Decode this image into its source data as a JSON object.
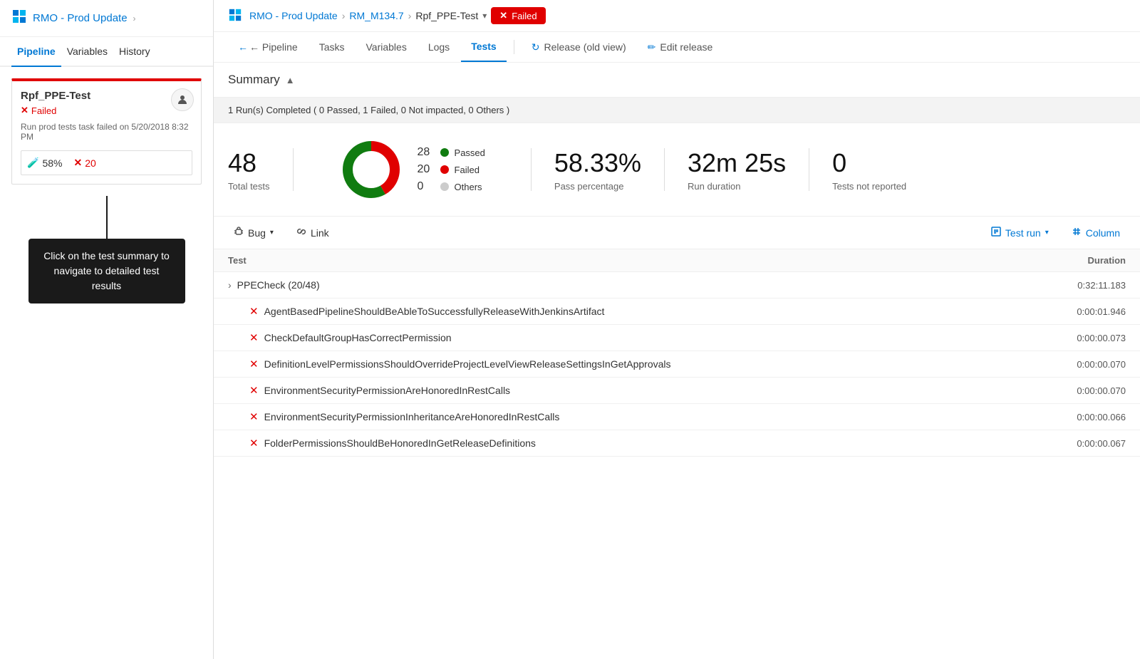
{
  "leftPanel": {
    "appIcon": "↑",
    "appTitle": "RMO - Prod Update",
    "navItems": [
      "Pipeline",
      "Variables",
      "History"
    ],
    "activeNavItem": "Pipeline",
    "stageCard": {
      "name": "Rpf_PPE-Test",
      "status": "Failed",
      "info": "Run prod tests task failed on 5/20/2018 8:32 PM",
      "passPercent": "58%",
      "failCount": "20"
    },
    "tooltip": "Click on the test summary to navigate to detailed test results"
  },
  "rightPanel": {
    "breadcrumb": {
      "appIcon": "↑",
      "appTitle": "RMO - Prod Update",
      "release": "RM_M134.7",
      "stage": "Rpf_PPE-Test",
      "status": "Failed"
    },
    "navItems": [
      {
        "label": "← Pipeline",
        "id": "pipeline"
      },
      {
        "label": "Tasks",
        "id": "tasks"
      },
      {
        "label": "Variables",
        "id": "variables"
      },
      {
        "label": "Logs",
        "id": "logs"
      },
      {
        "label": "Tests",
        "id": "tests",
        "active": true
      }
    ],
    "releaseOldView": "Release (old view)",
    "editRelease": "Edit release",
    "summary": {
      "title": "Summary",
      "runSummary": "1 Run(s) Completed ( 0 Passed, 1 Failed, 0 Not impacted, 0 Others )",
      "totalTests": "48",
      "totalTestsLabel": "Total tests",
      "donut": {
        "passed": 28,
        "failed": 20,
        "others": 0,
        "total": 48
      },
      "legend": [
        {
          "count": "28",
          "label": "Passed",
          "color": "green"
        },
        {
          "count": "20",
          "label": "Failed",
          "color": "red"
        },
        {
          "count": "0",
          "label": "Others",
          "color": "gray"
        }
      ],
      "passPercentage": "58.33%",
      "passPercentageLabel": "Pass percentage",
      "runDuration": "32m 25s",
      "runDurationLabel": "Run duration",
      "testsNotReported": "0",
      "testsNotReportedLabel": "Tests not reported"
    },
    "toolbar": {
      "bugLabel": "Bug",
      "linkLabel": "Link",
      "testRunLabel": "Test run",
      "columnLabel": "Column"
    },
    "tableHeaders": {
      "test": "Test",
      "duration": "Duration"
    },
    "testGroups": [
      {
        "name": "PPECheck (20/48)",
        "duration": "0:32:11.183",
        "tests": [
          {
            "name": "AgentBasedPipelineShouldBeAbleToSuccessfullyReleaseWithJenkinsArtifact",
            "duration": "0:00:01.946"
          },
          {
            "name": "CheckDefaultGroupHasCorrectPermission",
            "duration": "0:00:00.073"
          },
          {
            "name": "DefinitionLevelPermissionsShouldOverrideProjectLevelViewReleaseSettingsInGetApprovals",
            "duration": "0:00:00.070"
          },
          {
            "name": "EnvironmentSecurityPermissionAreHonoredInRestCalls",
            "duration": "0:00:00.070"
          },
          {
            "name": "EnvironmentSecurityPermissionInheritanceAreHonoredInRestCalls",
            "duration": "0:00:00.066"
          },
          {
            "name": "FolderPermissionsShouldBeHonoredInGetReleaseDefinitions",
            "duration": "0:00:00.067"
          }
        ]
      }
    ]
  }
}
